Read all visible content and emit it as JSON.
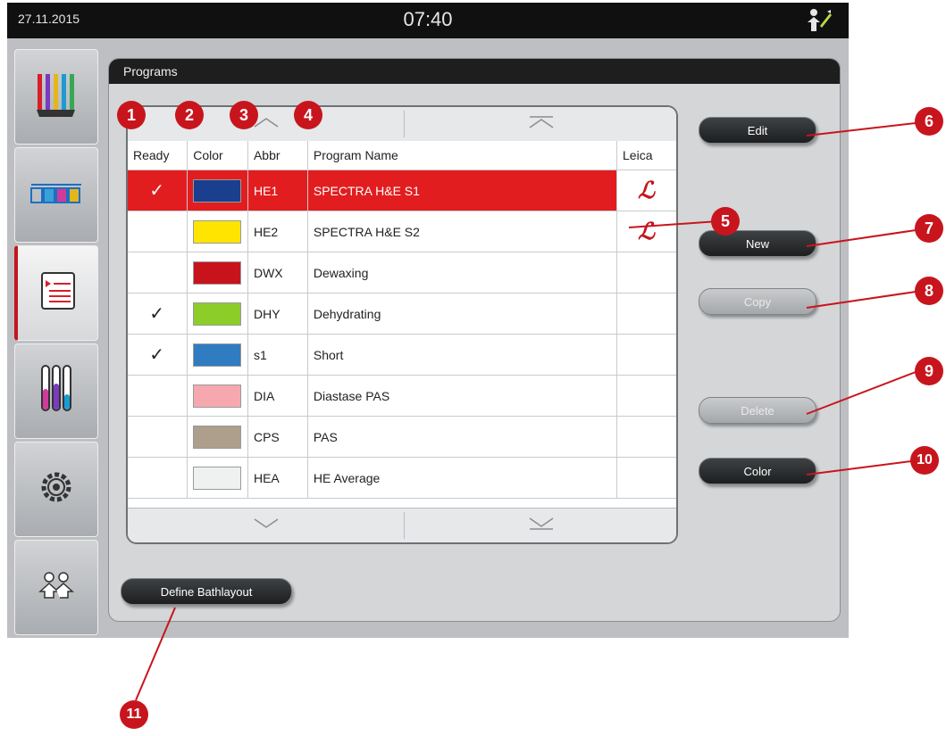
{
  "topbar": {
    "date": "27.11.2015",
    "time": "07:40"
  },
  "sidebar": {
    "items": [
      {
        "icon": "reagents-icon"
      },
      {
        "icon": "bath-layout-icon"
      },
      {
        "icon": "program-list-icon"
      },
      {
        "icon": "reagent-status-icon"
      },
      {
        "icon": "settings-icon"
      },
      {
        "icon": "user-settings-icon"
      }
    ]
  },
  "panel": {
    "title": "Programs"
  },
  "table": {
    "headers": [
      "Ready",
      "Color",
      "Abbr",
      "Program Name",
      "Leica"
    ],
    "rows": [
      {
        "ready": "✓",
        "color": "#1a3f8f",
        "abbr": "HE1",
        "name": "SPECTRA H&E S1",
        "leica": "ℒ",
        "selected": true
      },
      {
        "ready": "",
        "color": "#ffe400",
        "abbr": "HE2",
        "name": "SPECTRA H&E S2",
        "leica": "ℒ",
        "selected": false
      },
      {
        "ready": "",
        "color": "#c8131c",
        "abbr": "DWX",
        "name": "Dewaxing",
        "leica": "",
        "selected": false
      },
      {
        "ready": "✓",
        "color": "#8ccd2a",
        "abbr": "DHY",
        "name": "Dehydrating",
        "leica": "",
        "selected": false
      },
      {
        "ready": "✓",
        "color": "#2f7cc1",
        "abbr": "s1",
        "name": "Short",
        "leica": "",
        "selected": false
      },
      {
        "ready": "",
        "color": "#f5a9ae",
        "abbr": "DIA",
        "name": "Diastase PAS",
        "leica": "",
        "selected": false
      },
      {
        "ready": "",
        "color": "#ad9f8c",
        "abbr": "CPS",
        "name": "PAS",
        "leica": "",
        "selected": false
      },
      {
        "ready": "",
        "color": "#eff1f1",
        "abbr": "HEA",
        "name": "HE Average",
        "leica": "",
        "selected": false
      }
    ]
  },
  "buttons": {
    "edit": "Edit",
    "new": "New",
    "copy": "Copy",
    "delete": "Delete",
    "color": "Color",
    "define_bathlayout": "Define Bathlayout"
  },
  "callouts": [
    "1",
    "2",
    "3",
    "4",
    "5",
    "6",
    "7",
    "8",
    "9",
    "10",
    "11"
  ],
  "colors": {
    "accent": "#c8151d",
    "selected_row": "#e21d1f",
    "topbar": "#101010"
  }
}
